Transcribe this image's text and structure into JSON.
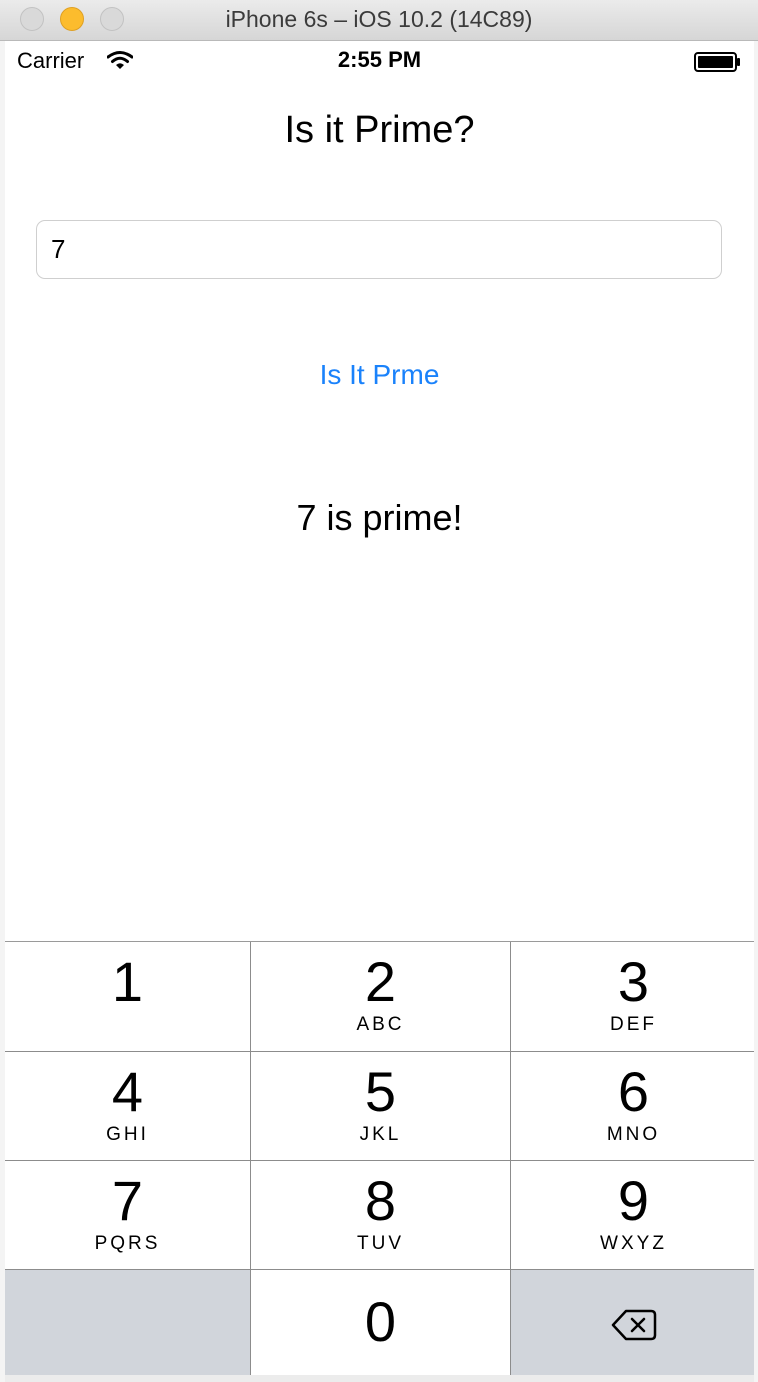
{
  "window": {
    "title": "iPhone 6s – iOS 10.2 (14C89)"
  },
  "status_bar": {
    "carrier": "Carrier",
    "time": "2:55 PM",
    "icons": [
      "wifi-icon",
      "battery-icon"
    ]
  },
  "app": {
    "title": "Is it Prime?",
    "input_value": "7",
    "button_label": "Is It Prme",
    "result": "7 is prime!"
  },
  "colors": {
    "accent": "#1a82fb",
    "key_background": "#ffffff",
    "key_dark_background": "#d1d5db"
  },
  "keypad": {
    "keys": [
      {
        "digit": "1",
        "letters": ""
      },
      {
        "digit": "2",
        "letters": "ABC"
      },
      {
        "digit": "3",
        "letters": "DEF"
      },
      {
        "digit": "4",
        "letters": "GHI"
      },
      {
        "digit": "5",
        "letters": "JKL"
      },
      {
        "digit": "6",
        "letters": "MNO"
      },
      {
        "digit": "7",
        "letters": "PQRS"
      },
      {
        "digit": "8",
        "letters": "TUV"
      },
      {
        "digit": "9",
        "letters": "WXYZ"
      },
      {
        "digit": "0",
        "letters": ""
      }
    ],
    "backspace_icon": "backspace-icon"
  }
}
